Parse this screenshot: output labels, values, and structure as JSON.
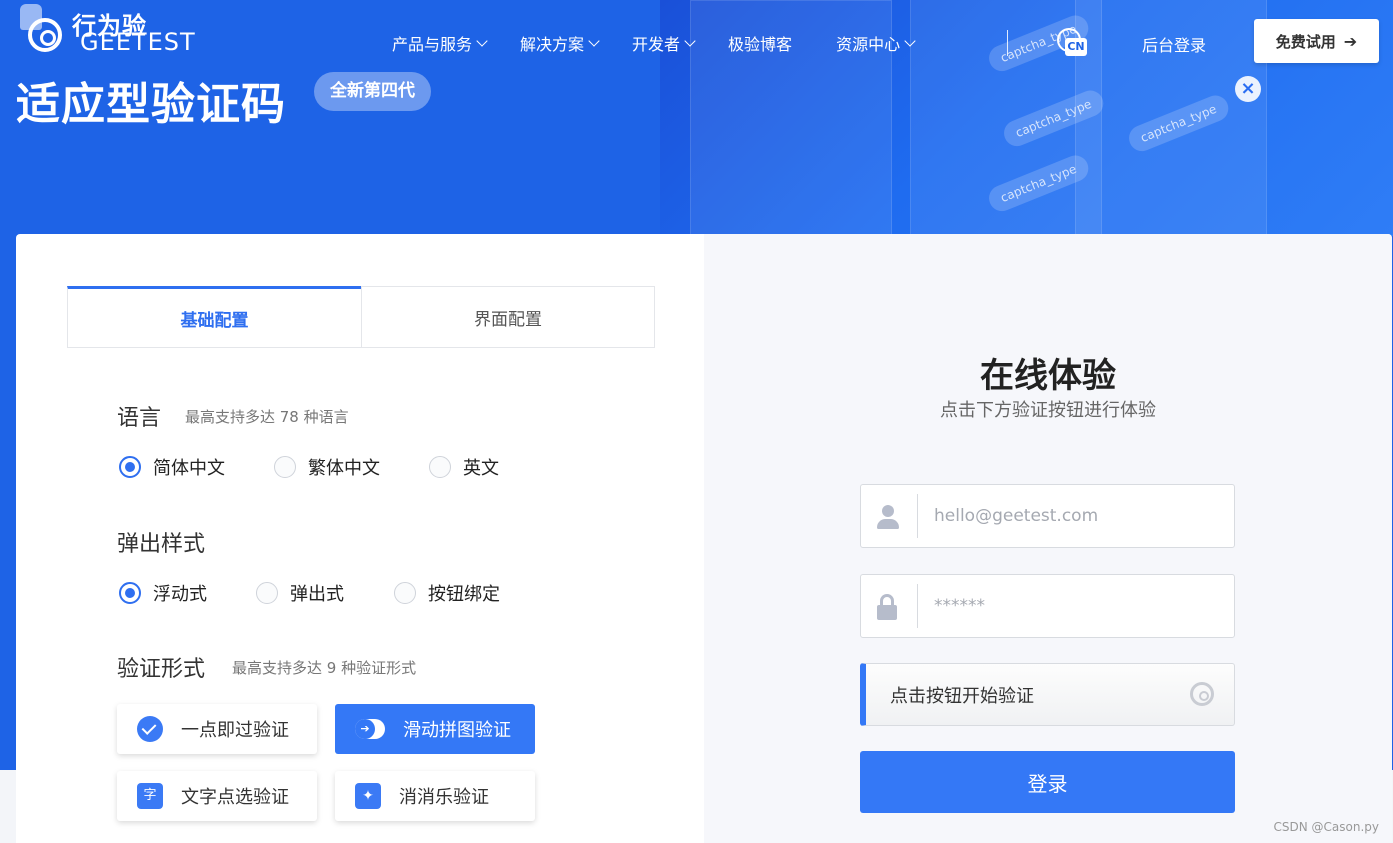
{
  "brand": {
    "name_cn": "行为验",
    "name_en": "GEETEST"
  },
  "nav": {
    "items": [
      {
        "label": "产品与服务",
        "has_dropdown": true
      },
      {
        "label": "解决方案",
        "has_dropdown": true
      },
      {
        "label": "开发者",
        "has_dropdown": true
      },
      {
        "label": "极验博客",
        "has_dropdown": false
      },
      {
        "label": "资源中心",
        "has_dropdown": true
      }
    ],
    "language_badge": "CN",
    "login_label": "后台登录",
    "trial_label": "免费试用",
    "trial_arrow": "➔"
  },
  "hero": {
    "title": "适应型验证码",
    "badge": "全新第四代",
    "deco_labels": [
      "captcha_type",
      "captcha_type",
      "captcha_type",
      "captcha_type"
    ]
  },
  "config": {
    "tabs": [
      {
        "label": "基础配置",
        "active": true
      },
      {
        "label": "界面配置",
        "active": false
      }
    ],
    "language": {
      "title": "语言",
      "note": "最高支持多达 78 种语言",
      "options": [
        {
          "label": "简体中文",
          "selected": true
        },
        {
          "label": "繁体中文",
          "selected": false
        },
        {
          "label": "英文",
          "selected": false
        }
      ]
    },
    "popup": {
      "title": "弹出样式",
      "options": [
        {
          "label": "浮动式",
          "selected": true
        },
        {
          "label": "弹出式",
          "selected": false
        },
        {
          "label": "按钮绑定",
          "selected": false
        }
      ]
    },
    "verify_type": {
      "title": "验证形式",
      "note": "最高支持多达 9 种验证形式",
      "options": [
        {
          "label": "一点即过验证",
          "icon": "check-cursor-icon",
          "selected": false
        },
        {
          "label": "滑动拼图验证",
          "icon": "slide-icon",
          "selected": true
        },
        {
          "label": "文字点选验证",
          "icon": "char-select-icon",
          "icon_text": "字",
          "selected": false
        },
        {
          "label": "消消乐验证",
          "icon": "sparkle-icon",
          "icon_text": "✦",
          "selected": false
        }
      ]
    }
  },
  "experience": {
    "title": "在线体验",
    "subtitle": "点击下方验证按钮进行体验",
    "email_placeholder": "hello@geetest.com",
    "password_placeholder": "******",
    "verify_label": "点击按钮开始验证",
    "login_label": "登录"
  },
  "watermark": "CSDN @Cason.py",
  "colors": {
    "primary": "#3478f6",
    "hero_bg": "#1e63e6"
  }
}
